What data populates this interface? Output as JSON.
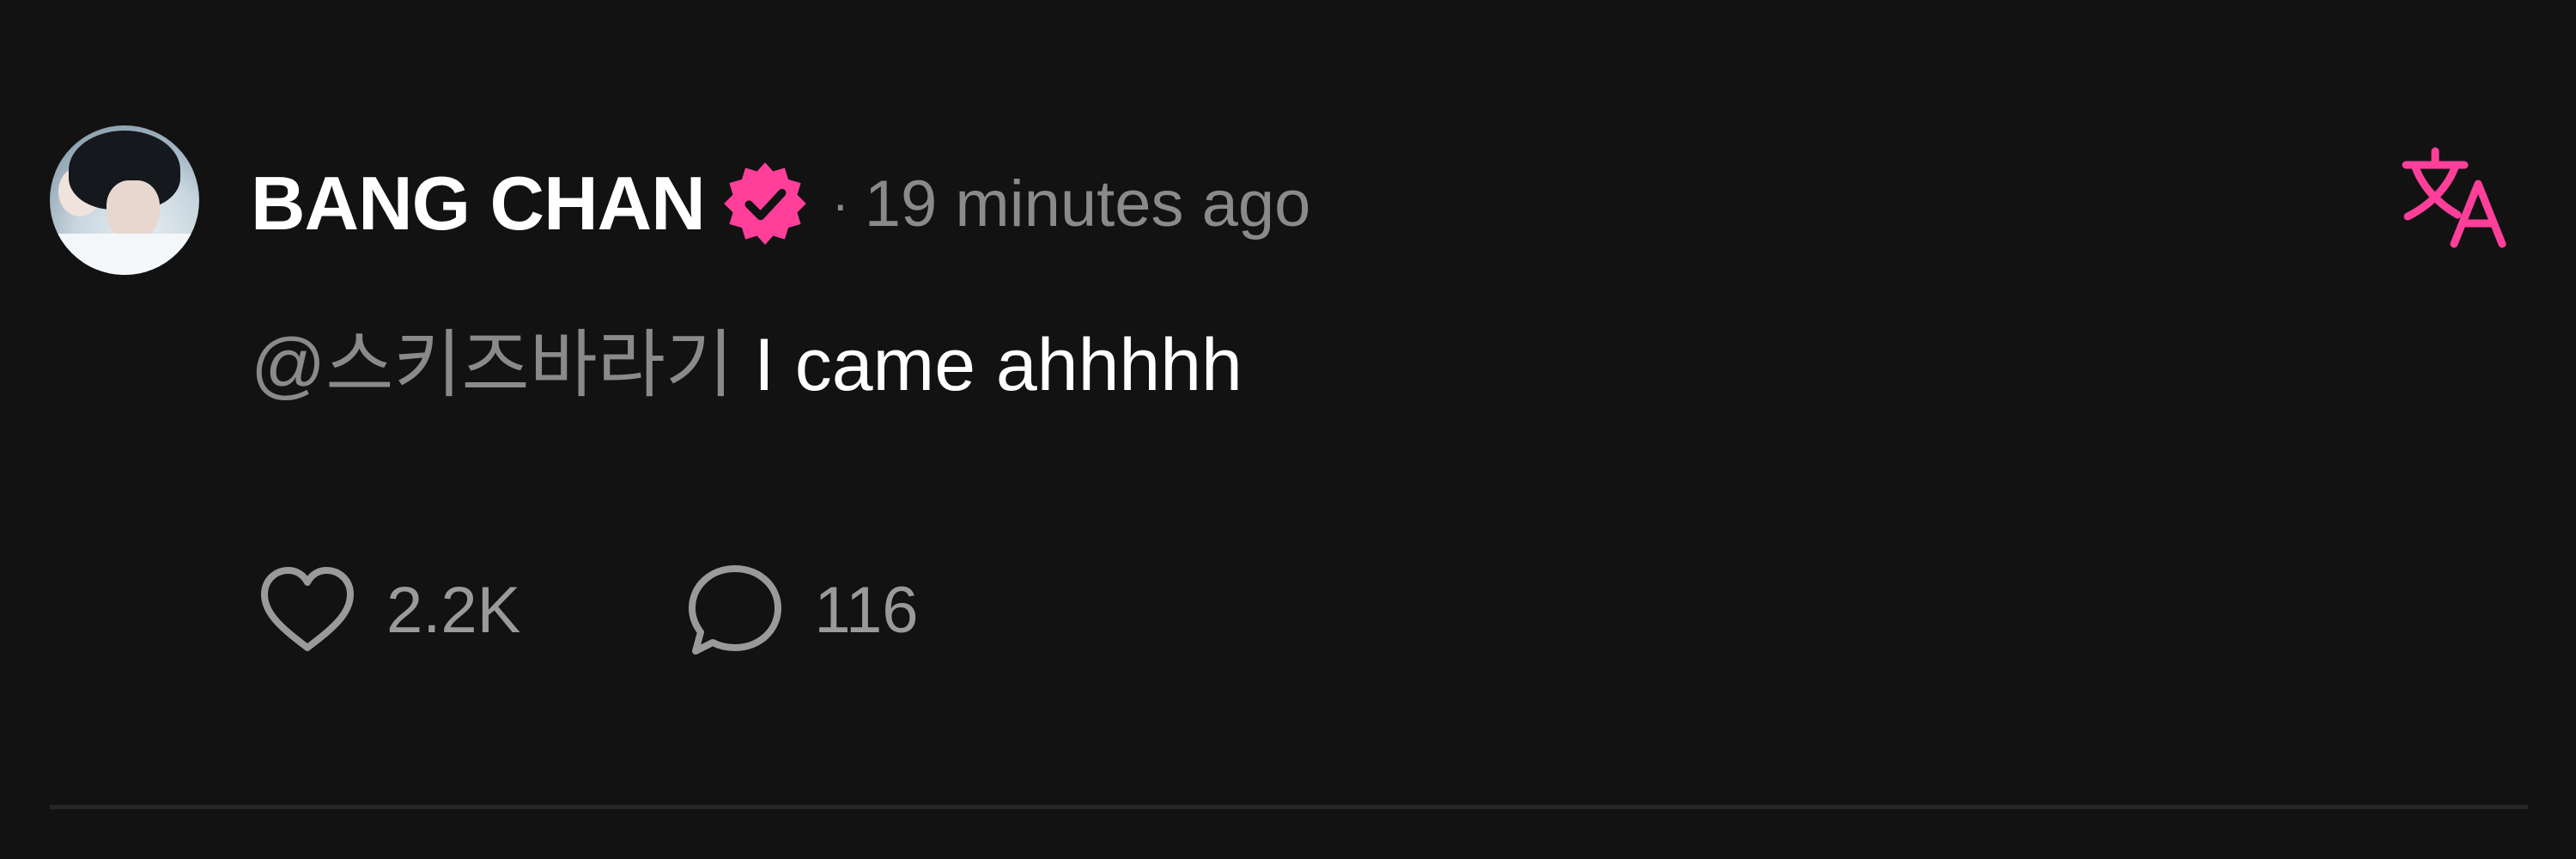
{
  "post": {
    "author": "BANG CHAN",
    "separator": "·",
    "timestamp": "19 minutes ago",
    "mention": "@스키즈바라기",
    "text": "I came ahhhhh",
    "likes": "2.2K",
    "comments": "116"
  },
  "icons": {
    "avatar": "profile-photo",
    "verified": "verified-badge-icon",
    "translate": "translate-icon",
    "like": "heart-icon",
    "comment": "comment-bubble-icon"
  },
  "colors": {
    "background": "#121212",
    "accent": "#ff3f9a",
    "text_primary": "#ffffff",
    "text_secondary": "#8a8a8a",
    "divider": "#262626"
  }
}
